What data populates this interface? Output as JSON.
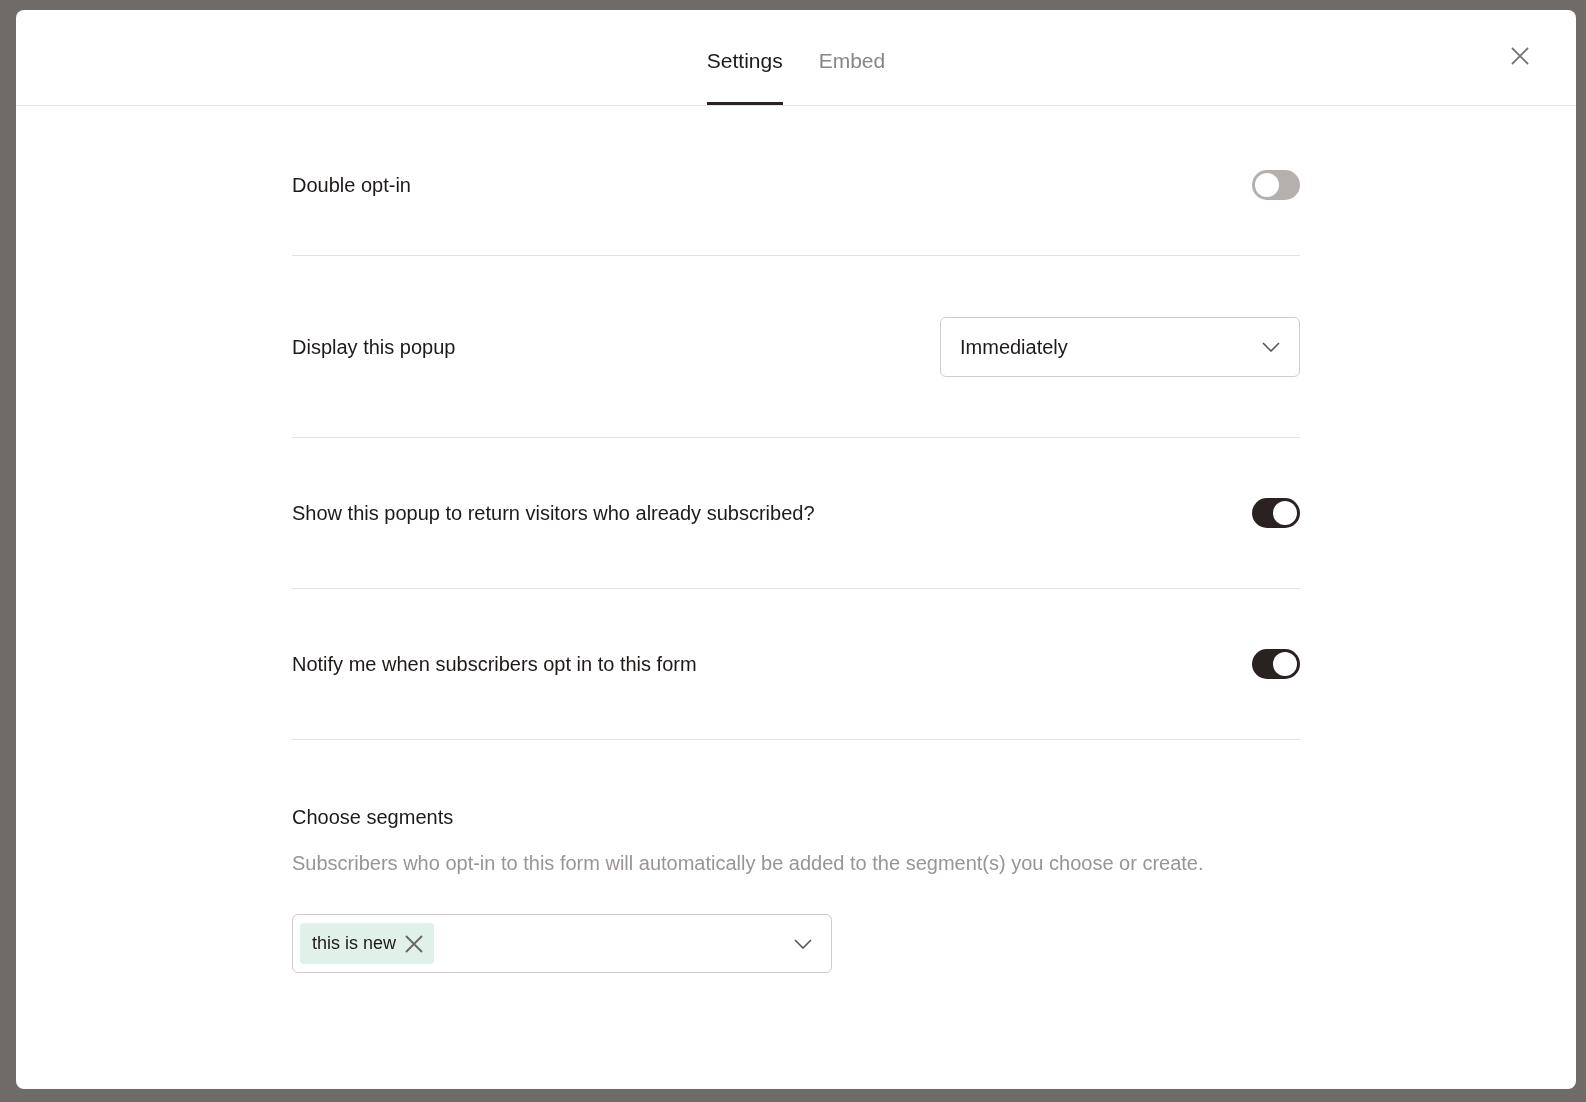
{
  "tabs": [
    {
      "label": "Settings",
      "selected": true
    },
    {
      "label": "Embed",
      "selected": false
    }
  ],
  "settings": [
    {
      "kind": "toggle",
      "label": "Double opt-in",
      "on": false
    },
    {
      "kind": "select",
      "label": "Display this popup",
      "value": "Immediately"
    },
    {
      "kind": "toggle",
      "label": "Show this popup to return visitors who already subscribed?",
      "on": true
    },
    {
      "kind": "toggle",
      "label": "Notify me when subscribers opt in to this form",
      "on": true
    }
  ],
  "segments": {
    "title": "Choose segments",
    "description": "Subscribers who opt-in to this form will automatically be added to the segment(s) you choose or create.",
    "tags": [
      "this is new"
    ]
  }
}
